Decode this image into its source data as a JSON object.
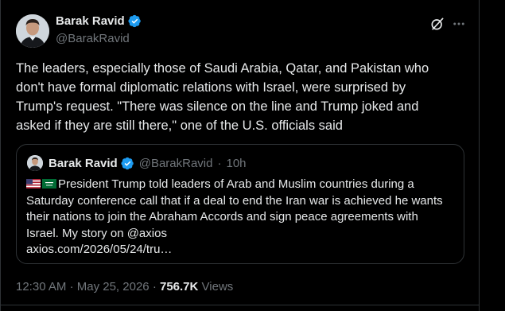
{
  "author": {
    "display_name": "Barak Ravid",
    "handle": "@BarakRavid",
    "verified": true
  },
  "tweet": {
    "text": "The leaders, especially those of Saudi Arabia, Qatar, and Pakistan who\ndon't have formal diplomatic relations with Israel, were surprised by\nTrump's request. \"There was silence on the line and Trump joked and\nasked if they are still there,\" one of the U.S. officials said"
  },
  "quoted_tweet": {
    "display_name": "Barak Ravid",
    "handle": "@BarakRavid",
    "separator": "·",
    "time_ago": "10h",
    "flags": [
      "us-flag",
      "saudi-flag"
    ],
    "text": "President Trump told leaders of Arab and Muslim countries during a\nSaturday conference call that if a deal to end the Iran war is achieved he wants\ntheir nations to join the Abraham Accords and sign peace agreements with\nIsrael. My story on @axios\naxios.com/2026/05/24/tru…"
  },
  "meta": {
    "time": "12:30 AM",
    "separator": "·",
    "date": "May 25, 2026",
    "separator2": "·",
    "views_count": "756.7K",
    "views_label": "Views"
  },
  "icons": {
    "grok": "grok-icon",
    "more": "more-icon",
    "verified": "verified-badge-icon"
  },
  "colors": {
    "background": "#000000",
    "text": "#e7e9ea",
    "secondary": "#71767b",
    "verified": "#1d9bf0",
    "border": "#2f3336"
  }
}
